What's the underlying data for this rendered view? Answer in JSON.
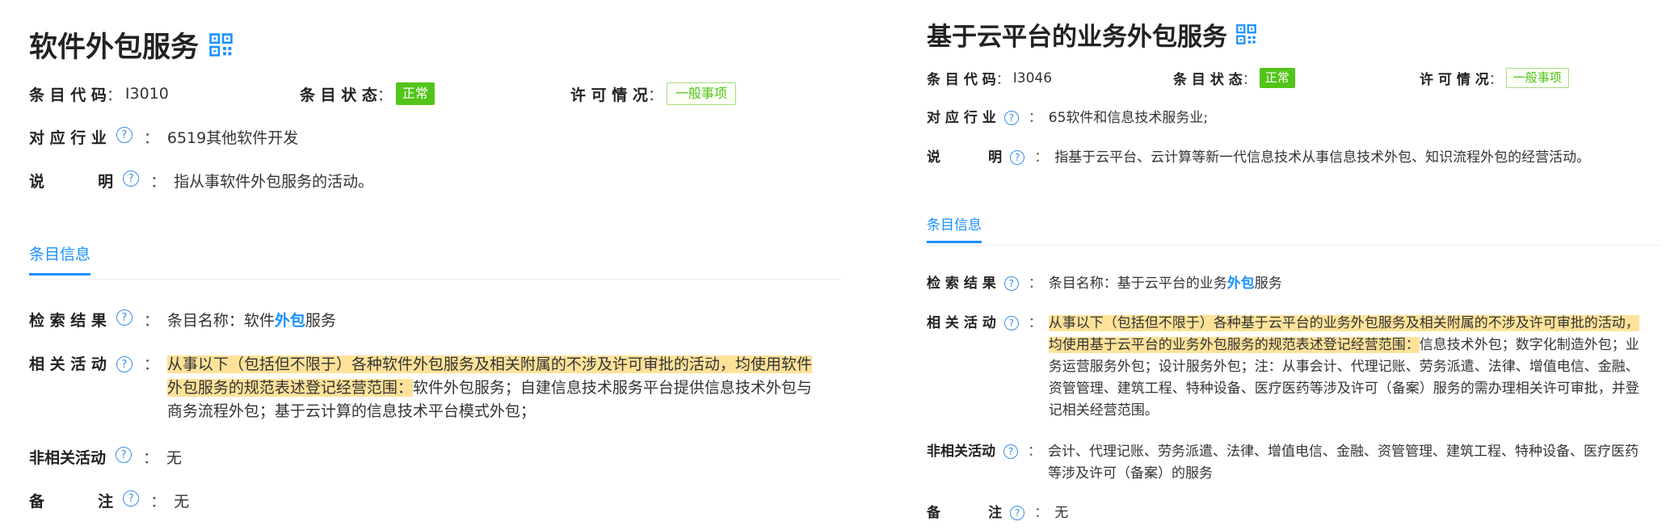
{
  "left": {
    "title": "软件外包服务",
    "code_label": "条 目 代 码",
    "code_value": "I3010",
    "status_label": "条 目 状 态",
    "status_value": "正常",
    "license_label": "许 可 情 况",
    "license_value": "一般事项",
    "industry_label": "对 应 行 业",
    "industry_value": "6519其他软件开发",
    "desc_label": "说          明",
    "desc_value": "指从事软件外包服务的活动。",
    "tab_label": "条目信息",
    "search_label": "检 索 结 果",
    "search_prefix": "条目名称：软件",
    "search_keyword": "外包",
    "search_suffix": "服务",
    "related_label": "相 关 活 动",
    "related_highlight": "从事以下（包括但不限于）各种软件外包服务及相关附属的不涉及许可审批的活动，均使用软件外包服务的规范表述登记经营范围：",
    "related_rest": "软件外包服务；自建信息技术服务平台提供信息技术外包与商务流程外包；基于云计算的信息技术平台模式外包；",
    "non_related_label": "非相关活动",
    "non_related_value": "无",
    "remark_label": "备          注",
    "remark_value": "无"
  },
  "right": {
    "title": "基于云平台的业务外包服务",
    "code_label": "条 目 代 码",
    "code_value": "I3046",
    "status_label": "条 目 状 态",
    "status_value": "正常",
    "license_label": "许 可 情 况",
    "license_value": "一般事项",
    "industry_label": "对 应 行 业",
    "industry_value": "65软件和信息技术服务业;",
    "desc_label": "说          明",
    "desc_value": "指基于云平台、云计算等新一代信息技术从事信息技术外包、知识流程外包的经营活动。",
    "tab_label": "条目信息",
    "search_label": "检 索 结 果",
    "search_prefix": "条目名称：基于云平台的业务",
    "search_keyword": "外包",
    "search_suffix": "服务",
    "related_label": "相 关 活 动",
    "related_highlight": "从事以下（包括但不限于）各种基于云平台的业务外包服务及相关附属的不涉及许可审批的活动，均使用基于云平台的业务外包服务的规范表述登记经营范围：",
    "related_rest": "信息技术外包；数字化制造外包；业务运营服务外包；设计服务外包；注：从事会计、代理记账、劳务派遣、法律、增值电信、金融、资管管理、建筑工程、特种设备、医疗医药等涉及许可（备案）服务的需办理相关许可审批，并登记相关经营范围。",
    "non_related_label": "非相关活动",
    "non_related_value": "会计、代理记账、劳务派遣、法律、增值电信、金融、资管管理、建筑工程、特种设备、医疗医药等涉及许可（备案）的服务",
    "remark_label": "备          注",
    "remark_value": "无"
  },
  "help_glyph": "?",
  "colon": "：",
  "colors": {
    "accent": "#1890ff",
    "status_green": "#52c41a",
    "highlight": "#ffe29a",
    "help_blue": "#3a8ee6"
  }
}
